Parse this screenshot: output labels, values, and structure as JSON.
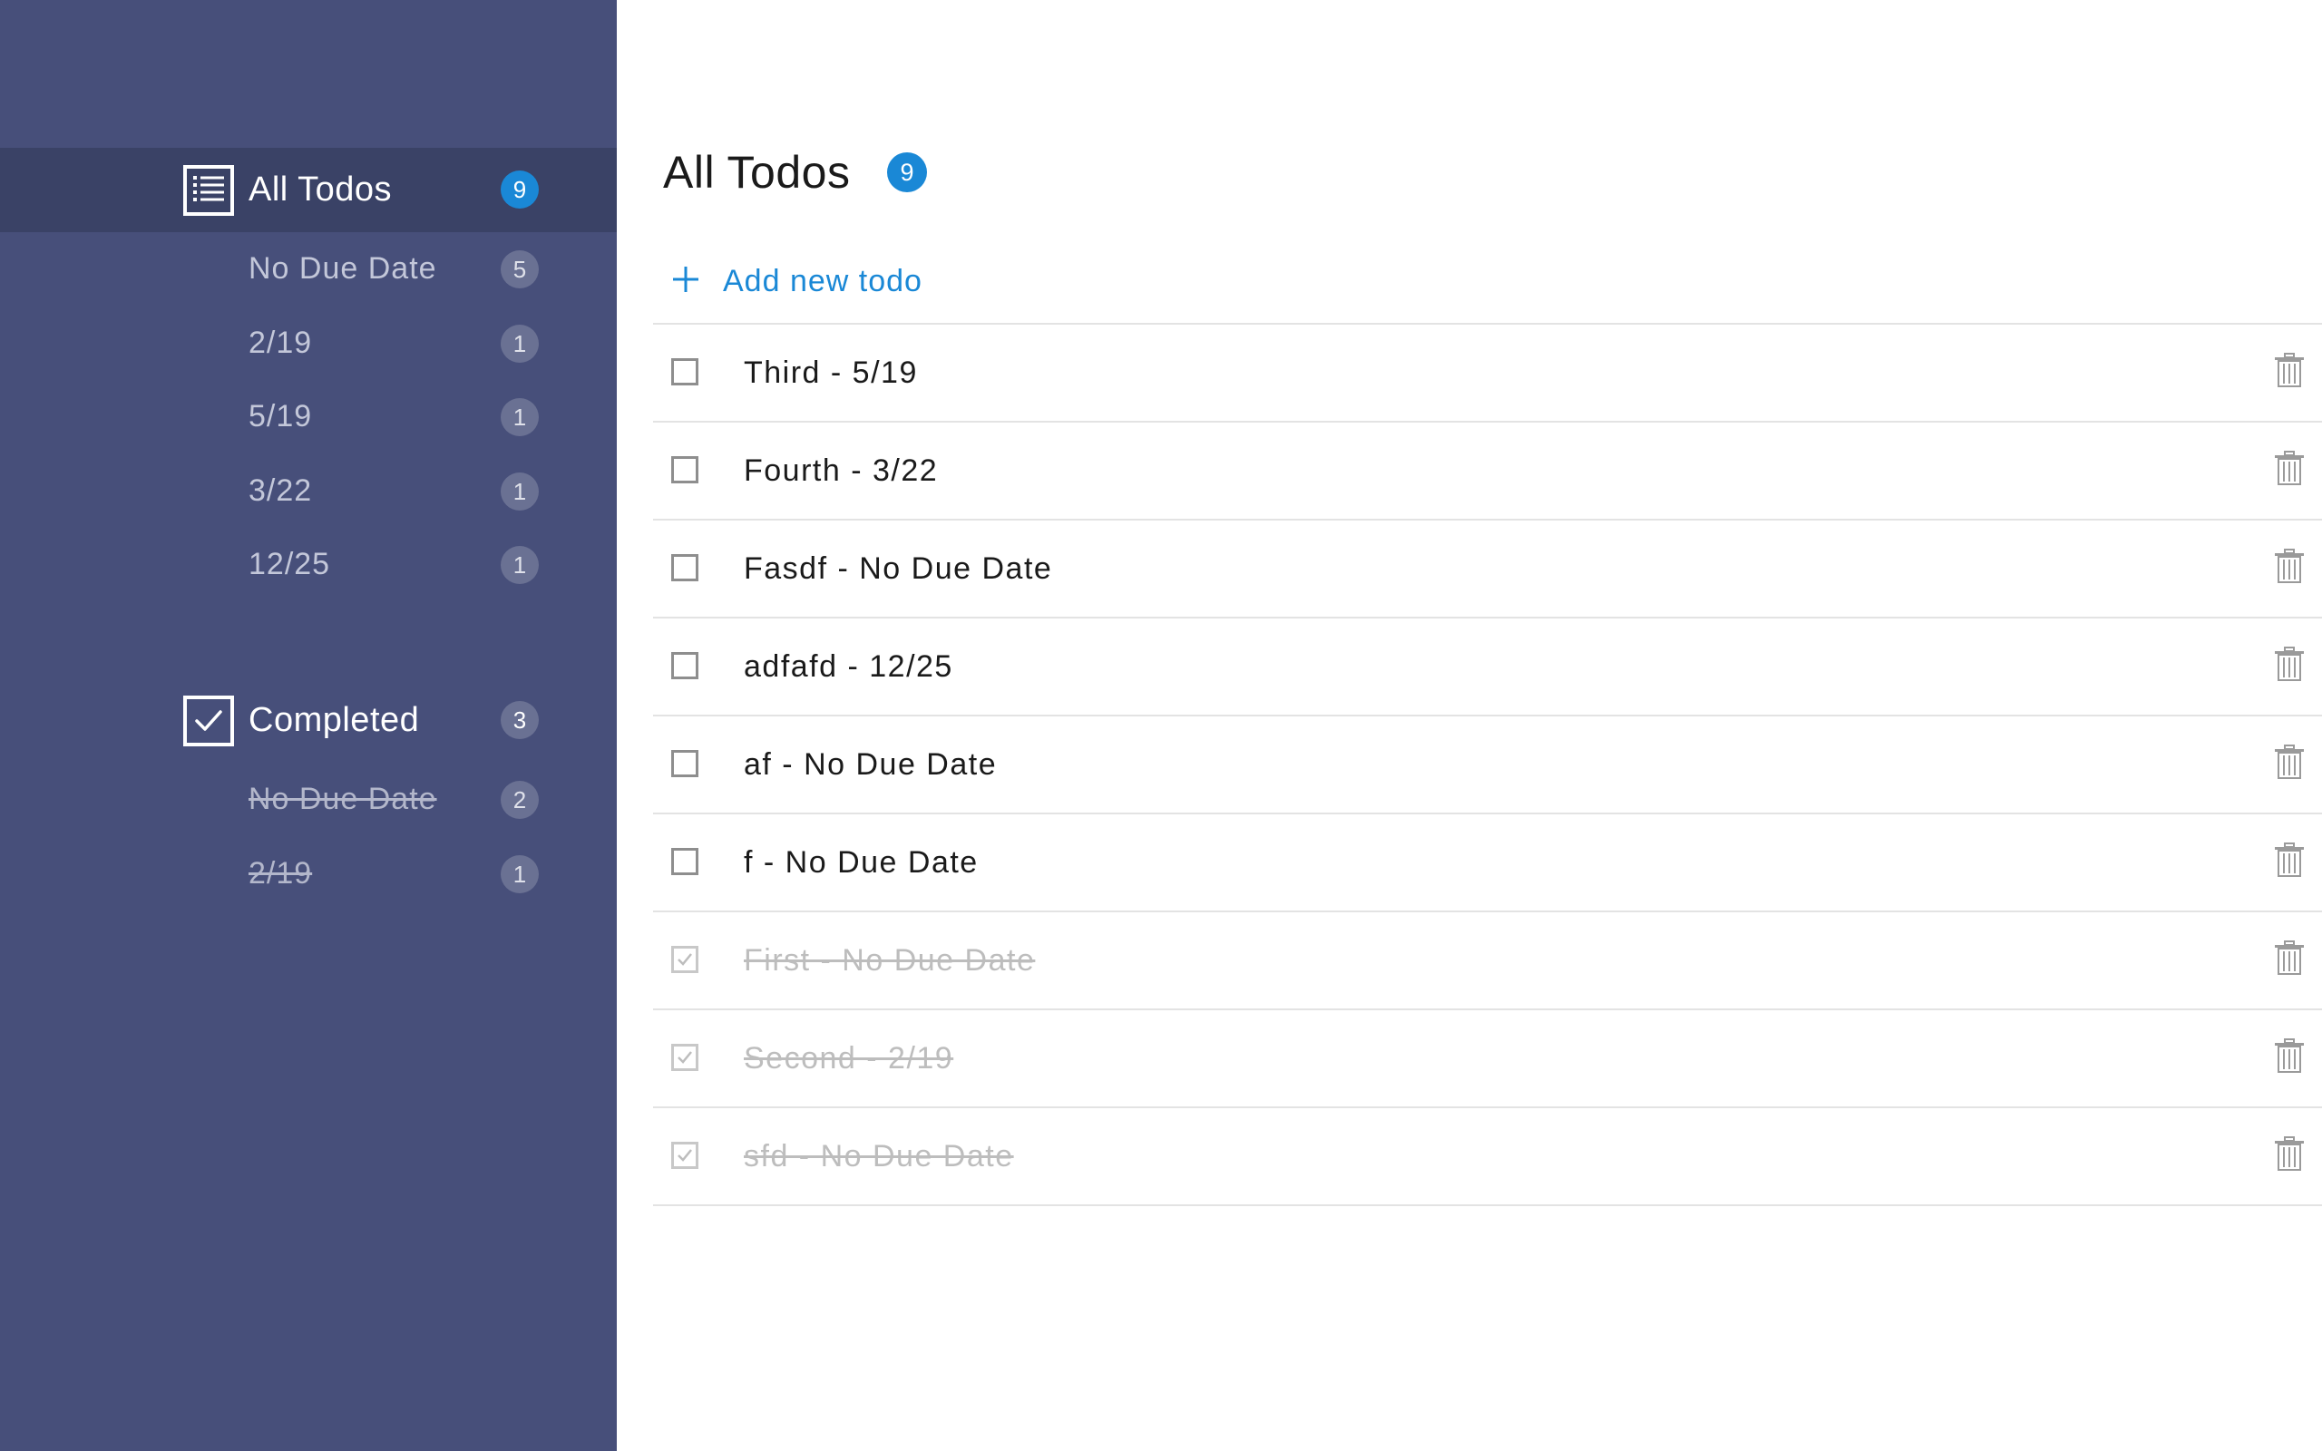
{
  "sidebar": {
    "all_todos": {
      "label": "All Todos",
      "count": "9",
      "icon": "list-icon",
      "items": [
        {
          "label": "No Due Date",
          "count": "5"
        },
        {
          "label": "2/19",
          "count": "1"
        },
        {
          "label": "5/19",
          "count": "1"
        },
        {
          "label": "3/22",
          "count": "1"
        },
        {
          "label": "12/25",
          "count": "1"
        }
      ]
    },
    "completed": {
      "label": "Completed",
      "count": "3",
      "icon": "checkbox-icon",
      "items": [
        {
          "label": "No Due Date",
          "count": "2"
        },
        {
          "label": "2/19",
          "count": "1"
        }
      ]
    }
  },
  "main": {
    "title": "All Todos",
    "count": "9",
    "add_label": "Add new todo",
    "todos": [
      {
        "text": "Third - 5/19",
        "completed": false
      },
      {
        "text": "Fourth - 3/22",
        "completed": false
      },
      {
        "text": "Fasdf - No Due Date",
        "completed": false
      },
      {
        "text": "adfafd - 12/25",
        "completed": false
      },
      {
        "text": "af - No Due Date",
        "completed": false
      },
      {
        "text": "f - No Due Date",
        "completed": false
      },
      {
        "text": "First - No Due Date",
        "completed": true
      },
      {
        "text": "Second - 2/19",
        "completed": true
      },
      {
        "text": "sfd - No Due Date",
        "completed": true
      }
    ]
  },
  "colors": {
    "sidebar_bg": "#474f7a",
    "sidebar_selected": "#3a4266",
    "accent": "#1a88d6",
    "badge_muted": "#6a7193"
  }
}
